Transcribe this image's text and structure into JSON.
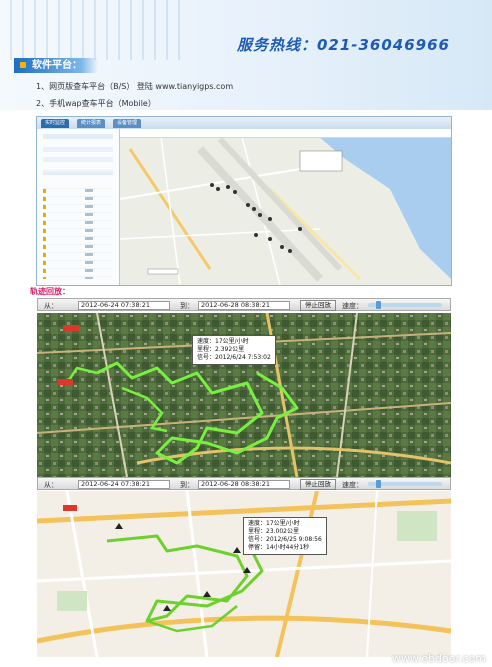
{
  "header": {
    "hotline": "服务热线：021-36046966"
  },
  "section": {
    "title": "软件平台：",
    "items": [
      {
        "text": "1、网页版查车平台（B/S）  登陆 www.tianyigps.com"
      },
      {
        "text": "2、手机wap查车平台（Mobile）"
      }
    ]
  },
  "platform": {
    "tabs": [
      "实时监控",
      "统计报表",
      "设备管理"
    ],
    "accent": "#2b6cb0"
  },
  "track": {
    "title": "轨迹回放：",
    "panel1": {
      "from_label": "从：",
      "from_value": "2012-06-24 07:38:21",
      "to_label": "到：",
      "to_value": "2012-06-28 08:38:21",
      "stop_button": "停止回放",
      "speed_label": "速度：",
      "popup": {
        "speed": "速度：17公里/小时",
        "mileage": "里程：2.392公里",
        "signal": "信号：2012/6/24 7:53:02"
      }
    },
    "panel2": {
      "from_label": "从：",
      "from_value": "2012-06-24 07:38:21",
      "to_label": "到：",
      "to_value": "2012-06-28 08:38:21",
      "stop_button": "停止回放",
      "speed_label": "速度：",
      "popup": {
        "speed": "速度：17公里/小时",
        "mileage": "里程：23.002公里",
        "signal": "信号：2012/6/25 9:08:56",
        "stay": "停留：14小时44分1秒"
      }
    }
  },
  "watermark": "www.ebdoor.com"
}
